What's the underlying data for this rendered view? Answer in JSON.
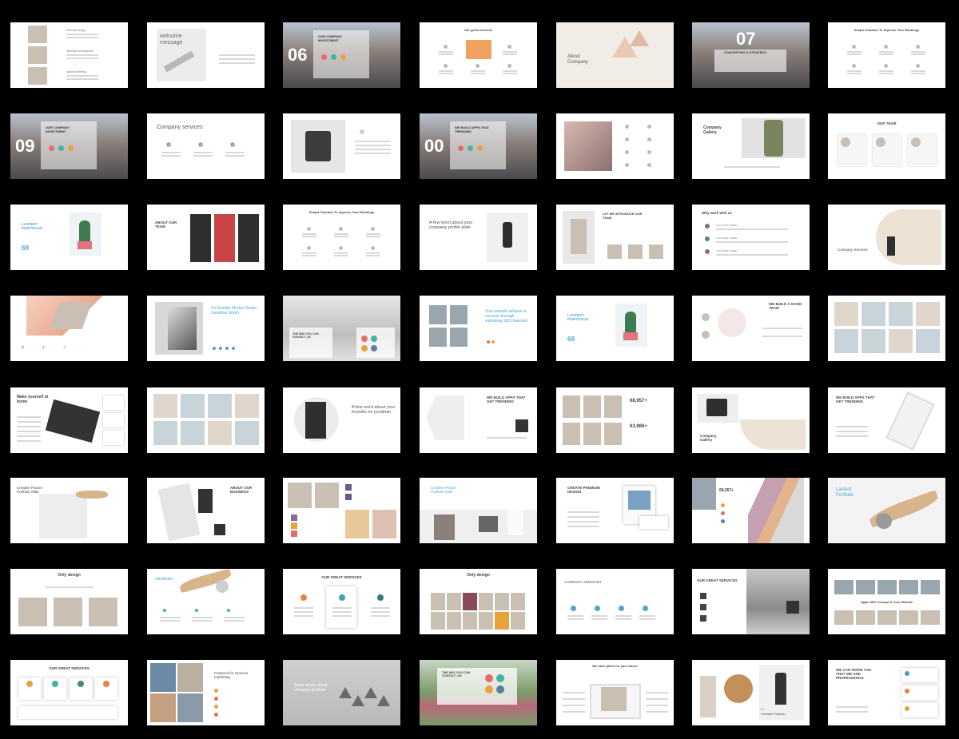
{
  "grid": {
    "cols": 7,
    "rows": 8
  },
  "slides": [
    {
      "kind": "list-people",
      "texts": [
        "Website Design",
        "Website Development",
        "Apple Marketing"
      ]
    },
    {
      "kind": "welcome",
      "title": "welcome message"
    },
    {
      "kind": "landscape-number",
      "title": "OUR COMPANY INVESTMENT",
      "number": "06"
    },
    {
      "kind": "services-grid",
      "title": "Our great services"
    },
    {
      "kind": "about-lamps",
      "title": "About Company"
    },
    {
      "kind": "landscape-number-top",
      "title": "CONCEPTING & STRATEGY",
      "number": "07"
    },
    {
      "kind": "services-grid",
      "title": "Simple Solution To Improve Your Rankings"
    },
    {
      "kind": "landscape-number",
      "title": "OUR COMPANY INVESTMENT",
      "number": "09"
    },
    {
      "kind": "services-row",
      "title": "Company services"
    },
    {
      "kind": "product-mug"
    },
    {
      "kind": "landscape-number",
      "title": "WE BUILD APPS THAT TRENDING",
      "number": "00"
    },
    {
      "kind": "photo-icons"
    },
    {
      "kind": "gallery-backpack",
      "title": "Company Gallery"
    },
    {
      "kind": "team-cards",
      "title": "OUR TEAM"
    },
    {
      "kind": "portfolio-cactus",
      "title": "LASTEST PORTFOLIO",
      "number": "69"
    },
    {
      "kind": "team-tshirts",
      "title": "ABOUT OUR TEAM"
    },
    {
      "kind": "services-grid",
      "title": "Simple Solution To Improve Your Rankings"
    },
    {
      "kind": "founder-word",
      "title": "A few word about your company profile slide"
    },
    {
      "kind": "introduce-team",
      "title": "LET ME INTRODUCE OUR TEAM"
    },
    {
      "kind": "why-work",
      "title": "Why work with us",
      "texts": [
        "YOUR TEXT HERE",
        "YOUR TEXT HERE",
        "YOUR TEXT HERE"
      ]
    },
    {
      "kind": "company-services-wood",
      "title": "Company Services"
    },
    {
      "kind": "diagonal-woman"
    },
    {
      "kind": "founder",
      "title": "I'm founder Modes Studio Jonathan Smith"
    },
    {
      "kind": "palms",
      "title": "THE WAY YOU CAN CONTACT US"
    },
    {
      "kind": "website-seo",
      "title": "Your website achieve a success through exploiting SEO featured"
    },
    {
      "kind": "portfolio-cactus",
      "title": "LASTEST PORTFOLIO",
      "number": "69"
    },
    {
      "kind": "good-team",
      "title": "WE BUILD A GOOD TEAM"
    },
    {
      "kind": "office-grid"
    },
    {
      "kind": "tablet",
      "title": "Make yourself at home"
    },
    {
      "kind": "office-grid"
    },
    {
      "kind": "founder-word-circle",
      "title": "A few word about your founder mr jonathan"
    },
    {
      "kind": "apps-trending-hex",
      "title": "WE BUILD APPS THAT GET TRENDING"
    },
    {
      "kind": "people-stats",
      "title": "68,957+",
      "subtitle": "63,986+"
    },
    {
      "kind": "gallery-mug",
      "title": "Company Gallery"
    },
    {
      "kind": "apps-trending-phone",
      "title": "WE BUILD APPS THAT GET TRENDING"
    },
    {
      "kind": "creative-picture",
      "title": "Creative Picture Portfolio Slide"
    },
    {
      "kind": "about-business",
      "title": "ABOUT OUR BUSINESS"
    },
    {
      "kind": "women-grid"
    },
    {
      "kind": "creative-picture-cups",
      "title": "Creative Picture Portfolio Slide"
    },
    {
      "kind": "premium-design",
      "title": "CREATE PREMIUM DESIGN"
    },
    {
      "kind": "stats-diagonal",
      "title": "68,957+"
    },
    {
      "kind": "latest-portfolio-chair",
      "title": "Lastest Portfolio"
    },
    {
      "kind": "only-design-3",
      "title": "Only design"
    },
    {
      "kind": "services-chair",
      "title": "services"
    },
    {
      "kind": "great-services-3",
      "title": "OUR GREAT SERVICES"
    },
    {
      "kind": "only-design-grid",
      "title": "Only design"
    },
    {
      "kind": "company-services-icons",
      "title": "COMPANY SERVICES"
    },
    {
      "kind": "great-services-mountain",
      "title": "OUR GREAT SERVICES"
    },
    {
      "kind": "seo-concept",
      "title": "Apple SEO Concept In Your Website"
    },
    {
      "kind": "great-services-4",
      "title": "OUR GREAT SERVICES"
    },
    {
      "kind": "featured-services",
      "title": "Featured for services marketing"
    },
    {
      "kind": "pendant-lamps",
      "title": "Some words about company portfolio"
    },
    {
      "kind": "field-contact",
      "title": "THE WAY YOU CAN CONTACT US"
    },
    {
      "kind": "plans",
      "title": "We have plans for your future"
    },
    {
      "kind": "creative-portfolio",
      "title": "Creative Portfolio",
      "number": "02"
    },
    {
      "kind": "professional",
      "title": "WE CAN SHOW YOU THAT WE ARE PROFESSIONAL"
    }
  ]
}
